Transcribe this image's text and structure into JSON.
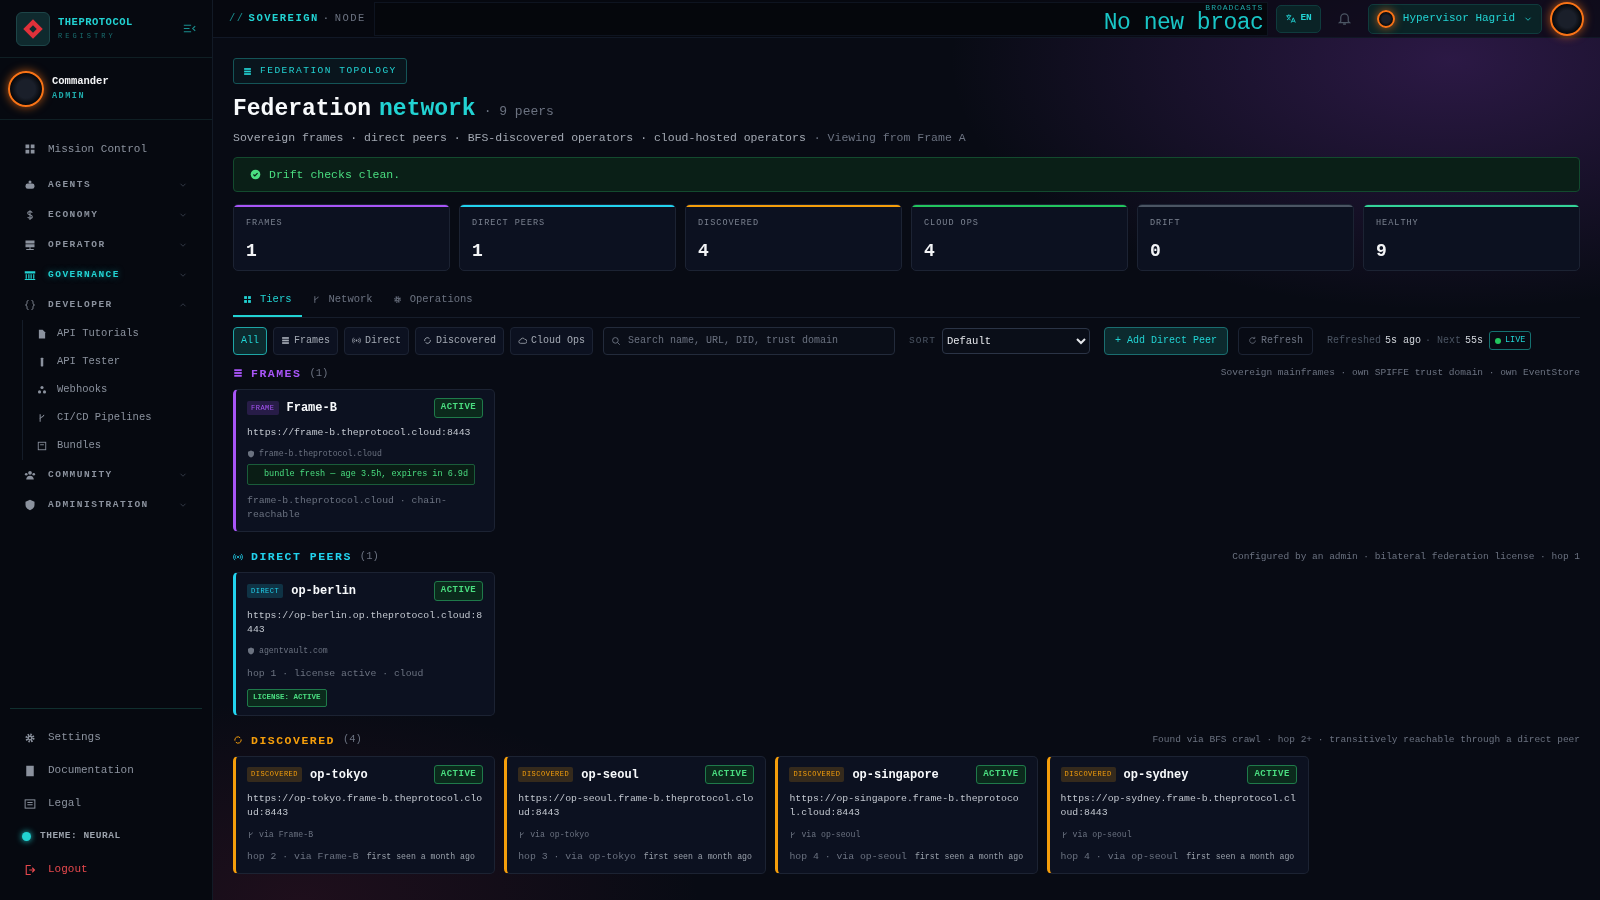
{
  "sidebar": {
    "brand": {
      "name": "THEPROTOCOL",
      "subtitle": "REGISTRY"
    },
    "user": {
      "name": "Commander",
      "role": "ADMIN"
    },
    "nav": [
      {
        "label": "Mission Control",
        "kind": "link",
        "selected": false
      },
      {
        "label": "AGENTS",
        "kind": "section",
        "selected": false,
        "expanded": false
      },
      {
        "label": "ECONOMY",
        "kind": "section",
        "selected": false,
        "expanded": false
      },
      {
        "label": "OPERATOR",
        "kind": "section",
        "selected": false,
        "expanded": false
      },
      {
        "label": "GOVERNANCE",
        "kind": "section",
        "selected": true,
        "expanded": false
      },
      {
        "label": "DEVELOPER",
        "kind": "section",
        "selected": false,
        "expanded": true,
        "children": [
          {
            "label": "API Tutorials",
            "selected": false
          },
          {
            "label": "API Tester",
            "selected": false
          },
          {
            "label": "Webhooks",
            "selected": false
          },
          {
            "label": "CI/CD Pipelines",
            "selected": false
          },
          {
            "label": "Bundles",
            "selected": false
          }
        ]
      },
      {
        "label": "COMMUNITY",
        "kind": "section",
        "selected": false,
        "expanded": false
      },
      {
        "label": "ADMINISTRATION",
        "kind": "section",
        "selected": false,
        "expanded": false
      }
    ],
    "footer": [
      {
        "label": "Settings",
        "kind": "link"
      },
      {
        "label": "Documentation",
        "kind": "link"
      },
      {
        "label": "Legal",
        "kind": "link"
      },
      {
        "label": "THEME: NEURAL",
        "kind": "theme"
      },
      {
        "label": "Logout",
        "kind": "danger"
      }
    ]
  },
  "topbar": {
    "path": [
      {
        "label": "//",
        "kind": "sep"
      },
      {
        "label": "SOVEREIGN",
        "kind": "main"
      },
      {
        "label": "·",
        "kind": "dot"
      },
      {
        "label": "NODE",
        "kind": "sub"
      }
    ],
    "ticker": {
      "label": "BROADCASTS",
      "text": "No new broac"
    },
    "language": "EN",
    "user": "Hypervisor Hagrid"
  },
  "header": {
    "badge": "FEDERATION TOPOLOGY",
    "title": "Federation",
    "title_accent": "network",
    "count": "· 9 peers",
    "subtitle": "Sovereign frames · direct peers · BFS-discovered operators · cloud-hosted operators",
    "viewing": "· Viewing from Frame A"
  },
  "alert": "Drift checks clean.",
  "stats": [
    {
      "label": "FRAMES",
      "value": "1",
      "color": "#a855f7"
    },
    {
      "label": "DIRECT PEERS",
      "value": "1",
      "color": "#22d3ee"
    },
    {
      "label": "DISCOVERED",
      "value": "4",
      "color": "#f59e0b"
    },
    {
      "label": "CLOUD OPS",
      "value": "4",
      "color": "#22c55e"
    },
    {
      "label": "DRIFT",
      "value": "0",
      "color": "#4b5563"
    },
    {
      "label": "HEALTHY",
      "value": "9",
      "color": "#34d399"
    }
  ],
  "tabs": [
    {
      "label": "Tiers",
      "selected": true
    },
    {
      "label": "Network",
      "selected": false
    },
    {
      "label": "Operations",
      "selected": false
    }
  ],
  "toolbar": {
    "filters": [
      {
        "label": "All",
        "selected": true
      },
      {
        "label": "Frames",
        "selected": false
      },
      {
        "label": "Direct",
        "selected": false
      },
      {
        "label": "Discovered",
        "selected": false
      },
      {
        "label": "Cloud Ops",
        "selected": false
      }
    ],
    "search": {
      "placeholder": "Search name, URL, DID, trust domain"
    },
    "sort": {
      "label": "SORT",
      "value": "Default"
    },
    "add_button": "+ Add Direct Peer",
    "refresh_button": "Refresh",
    "refreshed": [
      {
        "text": "Refreshed",
        "kind": "dim"
      },
      {
        "text": "5s ago",
        "kind": "value"
      },
      {
        "text": "· Next",
        "kind": "dim"
      },
      {
        "text": "55s",
        "kind": "value"
      }
    ],
    "live": "LIVE"
  },
  "sections": [
    {
      "title": "FRAMES",
      "count": "(1)",
      "color": "#a855f7",
      "description": "Sovereign mainframes · own SPIFFE trust domain · own EventStore",
      "cards": [
        {
          "tag": "FRAME",
          "name": "Frame-B",
          "status": "ACTIVE",
          "url": "https://frame-b.theprotocol.cloud:8443",
          "domain": "frame-b.theprotocol.cloud",
          "note": "bundle fresh — age 3.5h, expires in 6.9d",
          "meta": "frame-b.theprotocol.cloud · chain-reachable"
        }
      ]
    },
    {
      "title": "DIRECT PEERS",
      "count": "(1)",
      "color": "#22d3ee",
      "description": "Configured by an admin · bilateral federation license · hop 1",
      "cards": [
        {
          "tag": "DIRECT",
          "name": "op-berlin",
          "status": "ACTIVE",
          "url": "https://op-berlin.op.theprotocol.cloud:8443",
          "domain": "agentvault.com",
          "meta": "hop 1 · license active · cloud",
          "license": "LICENSE: ACTIVE"
        }
      ]
    },
    {
      "title": "DISCOVERED",
      "count": "(4)",
      "color": "#f59e0b",
      "description": "Found via BFS crawl · hop 2+ · transitively reachable through a direct peer",
      "cards": [
        {
          "tag": "DISCOVERED",
          "name": "op-tokyo",
          "status": "ACTIVE",
          "url": "https://op-tokyo.frame-b.theprotocol.cloud:8443",
          "via": "via Frame-B",
          "meta": "hop 2 · via Frame-B",
          "seen": "first seen a month ago"
        },
        {
          "tag": "DISCOVERED",
          "name": "op-seoul",
          "status": "ACTIVE",
          "url": "https://op-seoul.frame-b.theprotocol.cloud:8443",
          "via": "via op-tokyo",
          "meta": "hop 3 · via op-tokyo",
          "seen": "first seen a month ago"
        },
        {
          "tag": "DISCOVERED",
          "name": "op-singapore",
          "status": "ACTIVE",
          "url": "https://op-singapore.frame-b.theprotocol.cloud:8443",
          "via": "via op-seoul",
          "meta": "hop 4 · via op-seoul",
          "seen": "first seen a month ago"
        },
        {
          "tag": "DISCOVERED",
          "name": "op-sydney",
          "status": "ACTIVE",
          "url": "https://op-sydney.frame-b.theprotocol.cloud:8443",
          "via": "via op-seoul",
          "meta": "hop 4 · via op-seoul",
          "seen": "first seen a month ago"
        }
      ]
    }
  ]
}
